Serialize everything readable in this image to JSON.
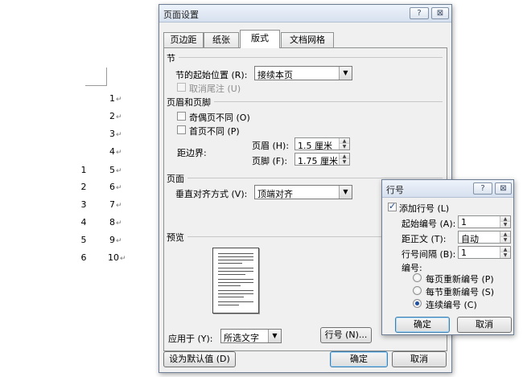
{
  "document": {
    "line_numbers": [
      "1",
      "2",
      "3",
      "4",
      "5",
      "6"
    ],
    "paragraph_numbers": [
      "1",
      "2",
      "3",
      "4",
      "5",
      "6",
      "7",
      "8",
      "9",
      "10"
    ],
    "paragraph_mark": "↵"
  },
  "page_setup": {
    "title": "页面设置",
    "help_label": "?",
    "close_label": "⊠",
    "tabs": [
      {
        "label": "页边距"
      },
      {
        "label": "纸张"
      },
      {
        "label": "版式"
      },
      {
        "label": "文档网格"
      }
    ],
    "active_tab": "版式",
    "section": {
      "heading": "节",
      "start_label": "节的起始位置 (R):",
      "start_value": "接续本页",
      "suppress_endnotes_label": "取消尾注 (U)",
      "suppress_endnotes_checked": false,
      "suppress_endnotes_enabled": false
    },
    "headers_footers": {
      "heading": "页眉和页脚",
      "odd_even_label": "奇偶页不同 (O)",
      "odd_even_checked": false,
      "first_page_label": "首页不同 (P)",
      "first_page_checked": false,
      "distance_label": "距边界:",
      "header_label": "页眉 (H):",
      "header_value": "1.5 厘米",
      "footer_label": "页脚 (F):",
      "footer_value": "1.75 厘米"
    },
    "page": {
      "heading": "页面",
      "valign_label": "垂直对齐方式 (V):",
      "valign_value": "顶端对齐"
    },
    "preview": {
      "heading": "预览"
    },
    "apply_to_label": "应用于 (Y):",
    "apply_to_value": "所选文字",
    "line_numbers_button": "行号 (N)...",
    "set_default_button": "设为默认值 (D)",
    "ok_button": "确定",
    "cancel_button": "取消"
  },
  "line_numbers_dialog": {
    "title": "行号",
    "help_label": "?",
    "close_label": "⊠",
    "add_line_numbers_label": "添加行号 (L)",
    "add_line_numbers_checked": true,
    "start_at_label": "起始编号 (A):",
    "start_at_value": "1",
    "from_text_label": "距正文 (T):",
    "from_text_value": "自动",
    "count_by_label": "行号间隔 (B):",
    "count_by_value": "1",
    "numbering_label": "编号:",
    "options": [
      {
        "label": "每页重新编号 (P)",
        "selected": false
      },
      {
        "label": "每节重新编号 (S)",
        "selected": false
      },
      {
        "label": "连续编号 (C)",
        "selected": true
      }
    ],
    "ok_button": "确定",
    "cancel_button": "取消"
  }
}
